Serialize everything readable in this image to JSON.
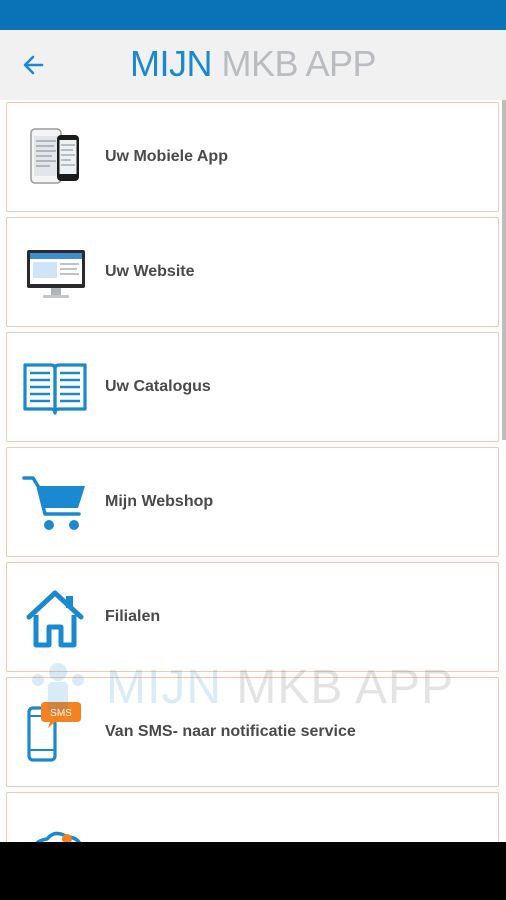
{
  "app_bar": {
    "title_bold": "MIJN",
    "title_light": "MKB APP"
  },
  "items": [
    {
      "label": "Uw Mobiele App",
      "icon": "mobile-devices-icon"
    },
    {
      "label": "Uw Website",
      "icon": "monitor-website-icon"
    },
    {
      "label": "Uw Catalogus",
      "icon": "open-book-icon"
    },
    {
      "label": "Mijn Webshop",
      "icon": "shopping-cart-icon"
    },
    {
      "label": "Filialen",
      "icon": "house-icon"
    },
    {
      "label": "Van SMS- naar notificatie service",
      "icon": "sms-phone-icon",
      "badge": "SMS"
    },
    {
      "label": "",
      "icon": "cloud-icon"
    }
  ],
  "watermark": {
    "bold": "MIJN",
    "light": "MKB APP"
  },
  "colors": {
    "status_bar": "#0a73b8",
    "accent": "#1a89cf",
    "card_border": "#f5c8b4",
    "sms_badge": "#f58220"
  }
}
